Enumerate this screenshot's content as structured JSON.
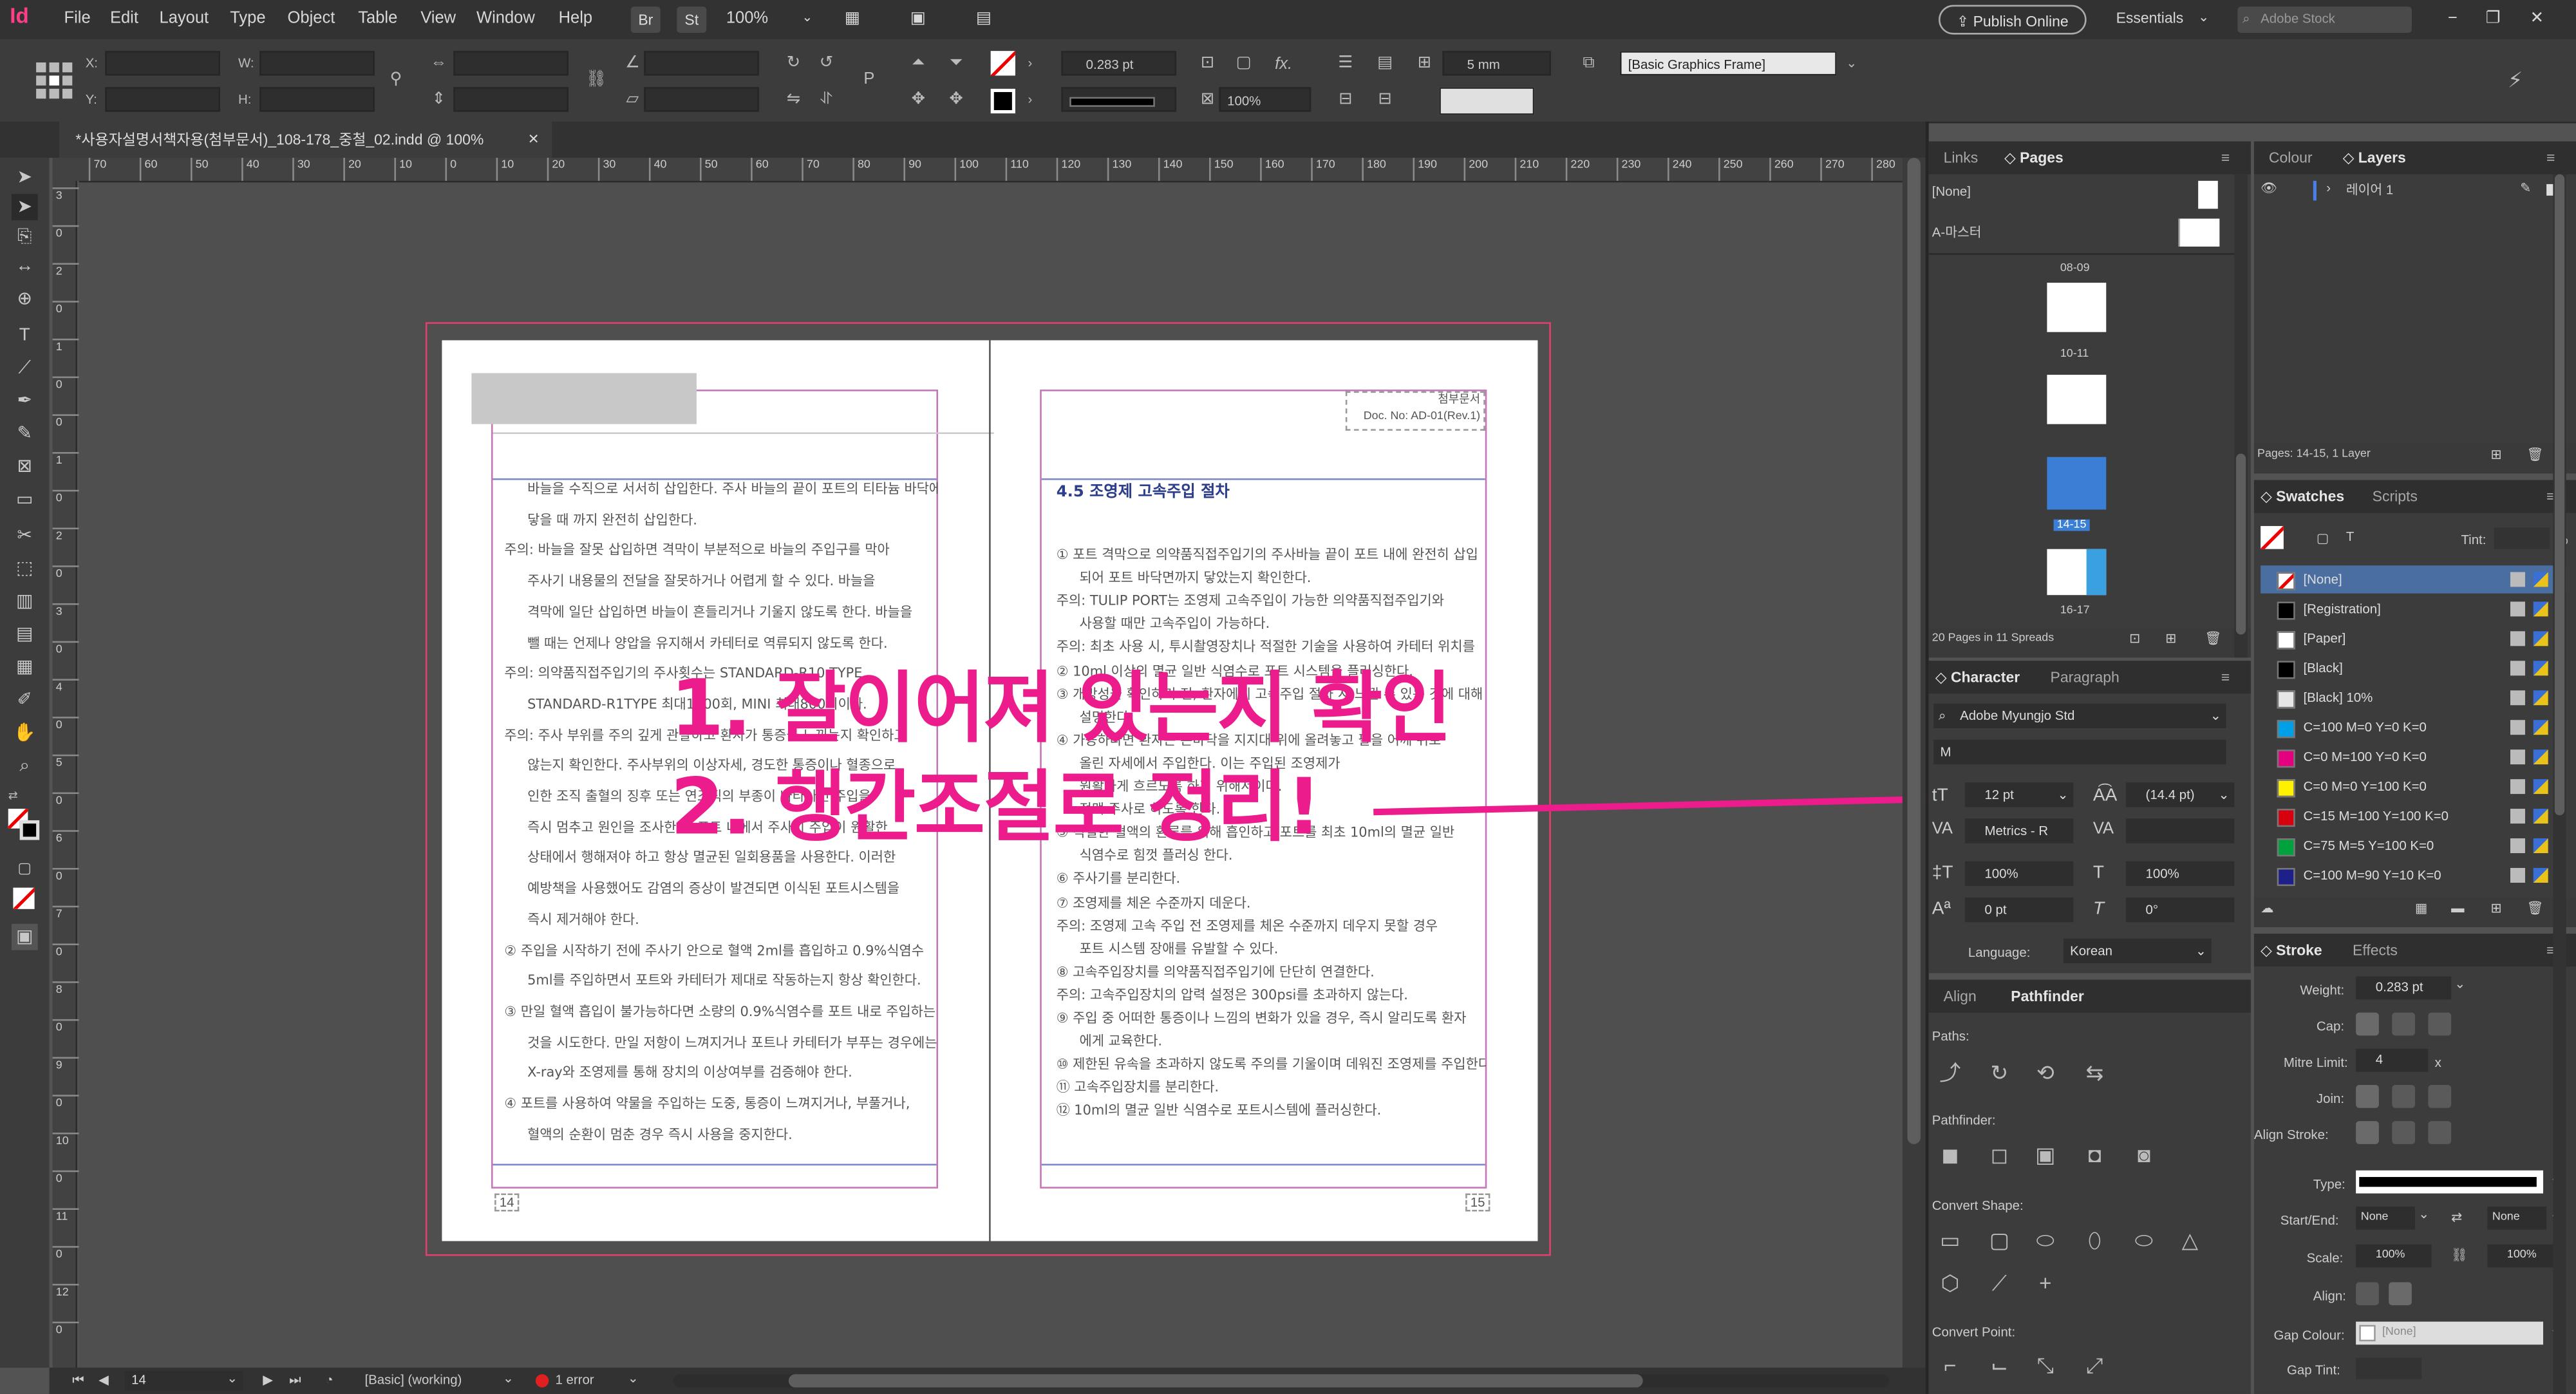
{
  "menubar": {
    "app_icon": "Id",
    "items": [
      "File",
      "Edit",
      "Layout",
      "Type",
      "Object",
      "Table",
      "View",
      "Window",
      "Help"
    ],
    "br_label": "Br",
    "st_label": "St",
    "zoom": "100%",
    "publish_online": "Publish Online",
    "workspace": "Essentials",
    "search_placeholder": "Adobe Stock"
  },
  "control": {
    "x_label": "X:",
    "y_label": "Y:",
    "w_label": "W:",
    "h_label": "H:",
    "stroke_weight": "0.283 pt",
    "opacity": "100%",
    "gap": "5 mm",
    "object_style": "[Basic Graphics Frame]",
    "fx_label": "fx."
  },
  "document": {
    "tab_title": "*사용자설명서책자용(첨부문서)_108-178_중철_02.indd @ 100%",
    "close_glyph": "×"
  },
  "hruler": {
    "labels": [
      "70",
      "60",
      "50",
      "40",
      "30",
      "20",
      "10",
      "0",
      "10",
      "20",
      "30",
      "40",
      "50",
      "60",
      "70",
      "80",
      "90",
      "100",
      "110",
      "120",
      "130",
      "140",
      "150",
      "160",
      "170",
      "180",
      "190",
      "200",
      "210",
      "220",
      "230",
      "240",
      "250",
      "260",
      "270",
      "280"
    ]
  },
  "vruler": {
    "labels": [
      "3",
      "0",
      "2",
      "0",
      "1",
      "0",
      "0",
      "1",
      "0",
      "2",
      "0",
      "3",
      "0",
      "4",
      "0",
      "5",
      "0",
      "6",
      "0",
      "7",
      "0",
      "8",
      "0",
      "9",
      "0",
      "10",
      "0",
      "11",
      "0",
      "12",
      "0"
    ]
  },
  "left_page": {
    "lines": [
      "바늘을 수직으로 서서히 삽입한다. 주사 바늘의 끝이 포트의 티타늄 바닥에",
      "닿을 때 까지 완전히 삽입한다.",
      "주의: 바늘을 잘못 삽입하면 격막이 부분적으로 바늘의 주입구를 막아",
      "주사기 내용물의 전달을 잘못하거나 어렵게 할 수 있다. 바늘을",
      "격막에 일단 삽입하면 바늘이 흔들리거나 기울지 않도록 한다. 바늘을",
      "뺄 때는 언제나 양압을 유지해서 카테터로 역류되지 않도록 한다.",
      "주의: 의약품직접주입기의 주사횟수는 STANDARD-R10 TYPE",
      "STANDARD-R1TYPE 최대1300회, MINI 최대800회이다.",
      "주의: 주사 부위를 주의 깊게 관찰하고 환자가 통증을 느끼는지 확인하고",
      "않는지 확인한다. 주사부위의 이상자세, 경도한 통증이나 혈종으로",
      "인한 조직 출혈의 징후 또는 연조직의 부종이 나타나면 주입을",
      "즉시 멈추고 원인을 조사한다. 포트 내에서 주사기 주입이 원활한",
      "상태에서 행해져야 하고 항상 멸균된 일회용품을 사용한다. 이러한",
      "예방책을 사용했어도 감염의 증상이 발견되면 이식된 포트시스템을",
      "즉시 제거해야 한다.",
      "② 주입을 시작하기 전에 주사기 안으로 혈액 2ml를 흡입하고 0.9%식염수",
      "5ml를 주입하면서 포트와 카테터가 제대로 작동하는지 항상 확인한다.",
      "③ 만일 혈액 흡입이 불가능하다면 소량의 0.9%식염수를 포트 내로 주입하는",
      "것을 시도한다. 만일 저항이 느껴지거나 포트나 카테터가 부푸는 경우에는",
      "X-ray와 조영제를 통해 장치의 이상여부를 검증해야 한다.",
      "④ 포트를 사용하여 약물을 주입하는 도중, 통증이 느껴지거나, 부풀거나,",
      "혈액의 순환이 멈춘 경우 즉시 사용을 중지한다."
    ],
    "page_number": "14"
  },
  "right_page": {
    "header_line1": "첨부문서",
    "header_line2": "Doc. No: AD-01(Rev.1)",
    "heading": "4.5 조영제 고속주입 절차",
    "lines": [
      "① 포트 격막으로 의약품직접주입기의 주사바늘 끝이 포트 내에 완전히 삽입",
      "되어 포트 바닥면까지 닿았는지 확인한다.",
      "주의: TULIP PORT는 조영제 고속주입이 가능한 의약품직접주입기와",
      "사용할 때만 고속주입이 가능하다.",
      "주의: 최초 사용 시, 투시촬영장치나 적절한 기술을 사용하여 카테터 위치를",
      "② 10ml 이상의 멸균 일반 식염수로 포트 시스템을 플러싱한다.",
      "③ 개방성을 확인하기 전, 환자에게 고속주입 절차 시 느낄 수 있는 것에 대해",
      "설명한다.",
      "④ 가능하다면 환자는 손바닥을 지지대 위에 올려놓고 팔을 어깨 위로",
      "올린 자세에서 주입한다. 이는 주입된 조영제가",
      "원활하게 흐르도록 하기 위해서이다.",
      "정맥 주사로 하도록 한다.",
      "⑤ 적절한 혈액의 환류를 위해 흡인하고 포트를 최초 10ml의 멸균 일반",
      "식염수로 힘껏 플러싱 한다.",
      "⑥ 주사기를 분리한다.",
      "⑦ 조영제를 체온 수준까지 데운다.",
      "주의: 조영제 고속 주입 전 조영제를 체온 수준까지 데우지 못할 경우",
      "포트 시스템 장애를 유발할 수 있다.",
      "⑧ 고속주입장치를 의약품직접주입기에 단단히 연결한다.",
      "주의: 고속주입장치의 압력 설정은 300psi를 초과하지 않는다.",
      "⑨ 주입 중 어떠한 통증이나 느낌의 변화가 있을 경우, 즉시 알리도록 환자",
      "에게 교육한다.",
      "⑩ 제한된 유속을 초과하지 않도록 주의를 기울이며 데워진 조영제를 주입한다.",
      "⑪ 고속주입장치를 분리한다.",
      "⑫ 10ml의 멸균 일반 식염수로 포트시스템에 플러싱한다."
    ],
    "page_number": "15"
  },
  "annotation": {
    "line1": "1. 잘이어져 있는지 확인",
    "line2": "2. 행간조절로 정리!",
    "color": "#ec1c8c"
  },
  "pages_panel": {
    "tabs": [
      "Links",
      "Pages"
    ],
    "none_label": "[None]",
    "master_label": "A-마스터",
    "spreads": [
      {
        "label": "08-09"
      },
      {
        "label": "10-11"
      },
      {
        "label": "14-15"
      },
      {
        "label": "16-17"
      }
    ],
    "footer": "20 Pages in 11 Spreads"
  },
  "layers_panel": {
    "tabs": [
      "Colour",
      "Layers"
    ],
    "layer_name": "레이어 1",
    "footer": "Pages: 14-15, 1 Layer"
  },
  "swatches_panel": {
    "tabs": [
      "Swatches",
      "Scripts"
    ],
    "tint_label": "Tint:",
    "tint_unit": "%",
    "swatches": [
      {
        "name": "[None]",
        "color": "#ffffff"
      },
      {
        "name": "[Registration]",
        "color": "#000000"
      },
      {
        "name": "[Paper]",
        "color": "#ffffff"
      },
      {
        "name": "[Black]",
        "color": "#000000"
      },
      {
        "name": "[Black] 10%",
        "color": "#e6e6e6"
      },
      {
        "name": "C=100 M=0 Y=0 K=0",
        "color": "#00a0e9"
      },
      {
        "name": "C=0 M=100 Y=0 K=0",
        "color": "#e4007f"
      },
      {
        "name": "C=0 M=0 Y=100 K=0",
        "color": "#fff100"
      },
      {
        "name": "C=15 M=100 Y=100 K=0",
        "color": "#d7000f"
      },
      {
        "name": "C=75 M=5 Y=100 K=0",
        "color": "#00a23e"
      },
      {
        "name": "C=100 M=90 Y=10 K=0",
        "color": "#1d2088"
      }
    ]
  },
  "character_panel": {
    "tabs": [
      "Character",
      "Paragraph"
    ],
    "font_family": "Adobe Myungjo Std",
    "font_style": "M",
    "font_size": "12 pt",
    "leading": "(14.4 pt)",
    "kerning": "Metrics - R",
    "vertical_scale": "100%",
    "horizontal_scale": "100%",
    "baseline_shift": "0 pt",
    "skew": "0°",
    "language_label": "Language:",
    "language": "Korean"
  },
  "pathfinder_panel": {
    "tabs": [
      "Align",
      "Pathfinder"
    ],
    "paths_label": "Paths:",
    "pathfinder_label": "Pathfinder:",
    "convert_shape_label": "Convert Shape:",
    "convert_point_label": "Convert Point:"
  },
  "stroke_panel": {
    "tabs": [
      "Stroke",
      "Effects"
    ],
    "weight_label": "Weight:",
    "weight": "0.283 pt",
    "cap_label": "Cap:",
    "miter_label": "Mitre Limit:",
    "miter": "4",
    "miter_unit": "x",
    "join_label": "Join:",
    "align_label": "Align Stroke:",
    "type_label": "Type:",
    "start_end_label": "Start/End:",
    "start": "None",
    "end": "None",
    "scale_label": "Scale:",
    "scale_start": "100%",
    "scale_end": "100%",
    "align2_label": "Align:",
    "gap_colour_label": "Gap Colour:",
    "gap_colour": "[None]",
    "gap_tint_label": "Gap Tint:"
  },
  "statusbar": {
    "page": "14",
    "master": "[Basic] (working)",
    "errors": "1 error"
  }
}
